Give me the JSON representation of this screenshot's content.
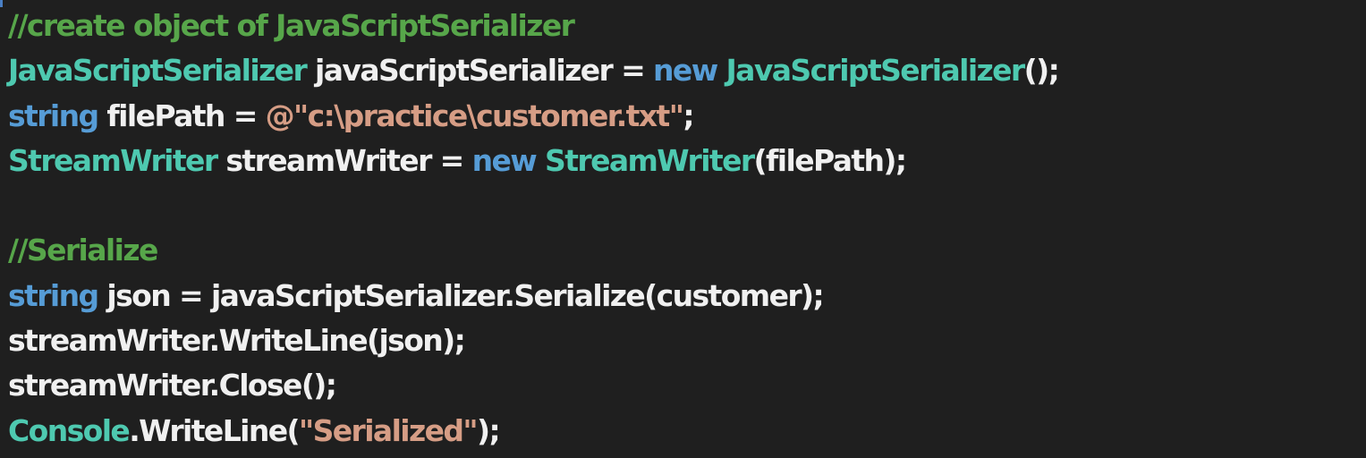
{
  "editor": {
    "colors": {
      "background": "#1f1f1f",
      "comment": "#57a64a",
      "type": "#4ec9b0",
      "keyword": "#569cd6",
      "string": "#d69d85",
      "plain": "#f0f0f0"
    },
    "lines": [
      {
        "tokens": [
          {
            "kind": "comment",
            "text": "//create object of JavaScriptSerializer"
          }
        ]
      },
      {
        "tokens": [
          {
            "kind": "type",
            "text": "JavaScriptSerializer"
          },
          {
            "kind": "plain",
            "text": " javaScriptSerializer = "
          },
          {
            "kind": "keyword",
            "text": "new"
          },
          {
            "kind": "plain",
            "text": " "
          },
          {
            "kind": "type",
            "text": "JavaScriptSerializer"
          },
          {
            "kind": "plain",
            "text": "();"
          }
        ]
      },
      {
        "tokens": [
          {
            "kind": "keyword",
            "text": "string"
          },
          {
            "kind": "plain",
            "text": " filePath = "
          },
          {
            "kind": "string",
            "text": "@\"c:\\practice\\customer.txt\""
          },
          {
            "kind": "plain",
            "text": ";"
          }
        ]
      },
      {
        "tokens": [
          {
            "kind": "type",
            "text": "StreamWriter"
          },
          {
            "kind": "plain",
            "text": " streamWriter = "
          },
          {
            "kind": "keyword",
            "text": "new"
          },
          {
            "kind": "plain",
            "text": " "
          },
          {
            "kind": "type",
            "text": "StreamWriter"
          },
          {
            "kind": "plain",
            "text": "(filePath);"
          }
        ]
      },
      {
        "tokens": []
      },
      {
        "tokens": [
          {
            "kind": "comment",
            "text": "//Serialize"
          }
        ]
      },
      {
        "tokens": [
          {
            "kind": "keyword",
            "text": "string"
          },
          {
            "kind": "plain",
            "text": " json = javaScriptSerializer.Serialize(customer);"
          }
        ]
      },
      {
        "tokens": [
          {
            "kind": "plain",
            "text": "streamWriter.WriteLine(json);"
          }
        ]
      },
      {
        "tokens": [
          {
            "kind": "plain",
            "text": "streamWriter.Close();"
          }
        ]
      },
      {
        "tokens": [
          {
            "kind": "type",
            "text": "Console"
          },
          {
            "kind": "plain",
            "text": ".WriteLine("
          },
          {
            "kind": "string",
            "text": "\"Serialized\""
          },
          {
            "kind": "plain",
            "text": ");"
          }
        ]
      }
    ]
  }
}
